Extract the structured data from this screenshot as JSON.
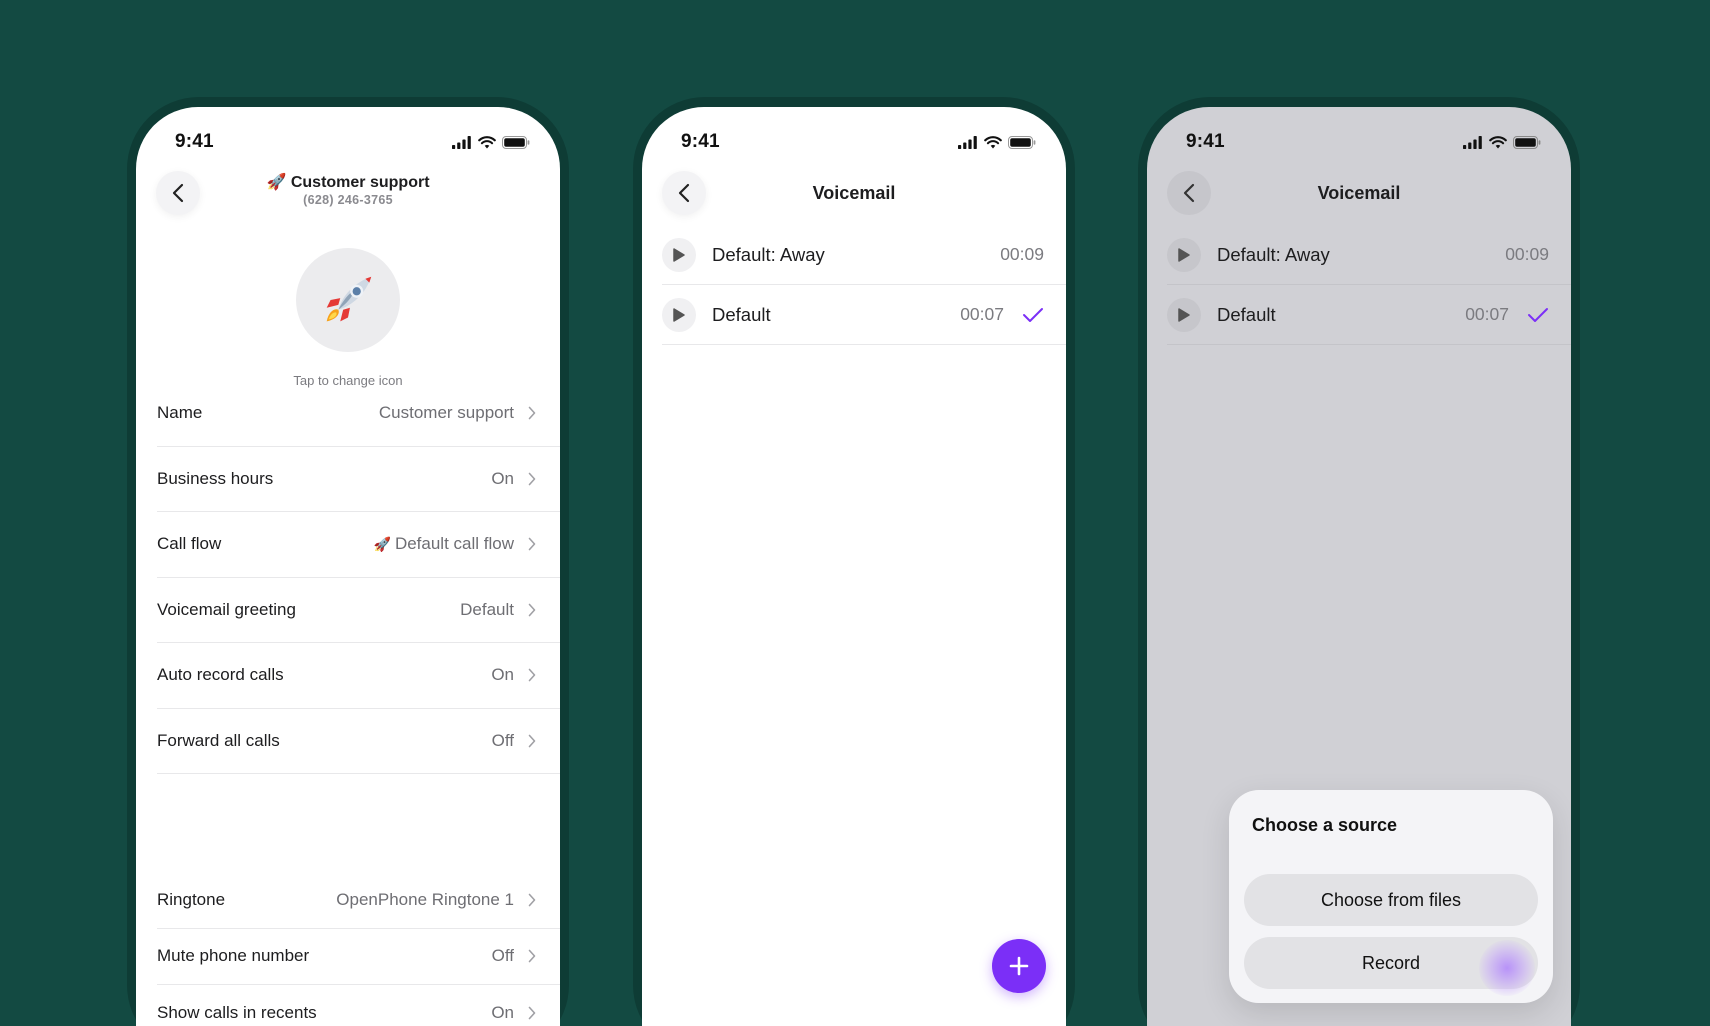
{
  "status_bar": {
    "time": "9:41"
  },
  "phone1": {
    "title": "Customer support",
    "subtitle": "(628) 246-3765",
    "tap_to_change": "Tap to change icon",
    "settings": [
      {
        "label": "Name",
        "value": "Customer support"
      },
      {
        "label": "Business hours",
        "value": "On"
      },
      {
        "label": "Call flow",
        "value": "Default call flow"
      },
      {
        "label": "Voicemail greeting",
        "value": "Default"
      },
      {
        "label": "Auto record calls",
        "value": "On"
      },
      {
        "label": "Forward all calls",
        "value": "Off"
      }
    ],
    "settings2": [
      {
        "label": "Ringtone",
        "value": "OpenPhone Ringtone 1"
      },
      {
        "label": "Mute phone number",
        "value": "Off"
      },
      {
        "label": "Show calls in recents",
        "value": "On"
      }
    ]
  },
  "phone2": {
    "title": "Voicemail",
    "items": [
      {
        "label": "Default: Away",
        "duration": "00:09",
        "selected": false
      },
      {
        "label": "Default",
        "duration": "00:07",
        "selected": true
      }
    ]
  },
  "phone3": {
    "title": "Voicemail",
    "items": [
      {
        "label": "Default: Away",
        "duration": "00:09",
        "selected": false
      },
      {
        "label": "Default",
        "duration": "00:07",
        "selected": true
      }
    ],
    "sheet": {
      "title": "Choose a source",
      "choose_files": "Choose from files",
      "record": "Record"
    }
  },
  "colors": {
    "background": "#134a42",
    "accent": "#7b2ff7"
  },
  "icons": [
    "back-chevron-icon",
    "signal-icon",
    "wifi-icon",
    "battery-icon",
    "rocket-icon",
    "chevron-right-icon",
    "play-icon",
    "checkmark-icon",
    "plus-icon"
  ]
}
